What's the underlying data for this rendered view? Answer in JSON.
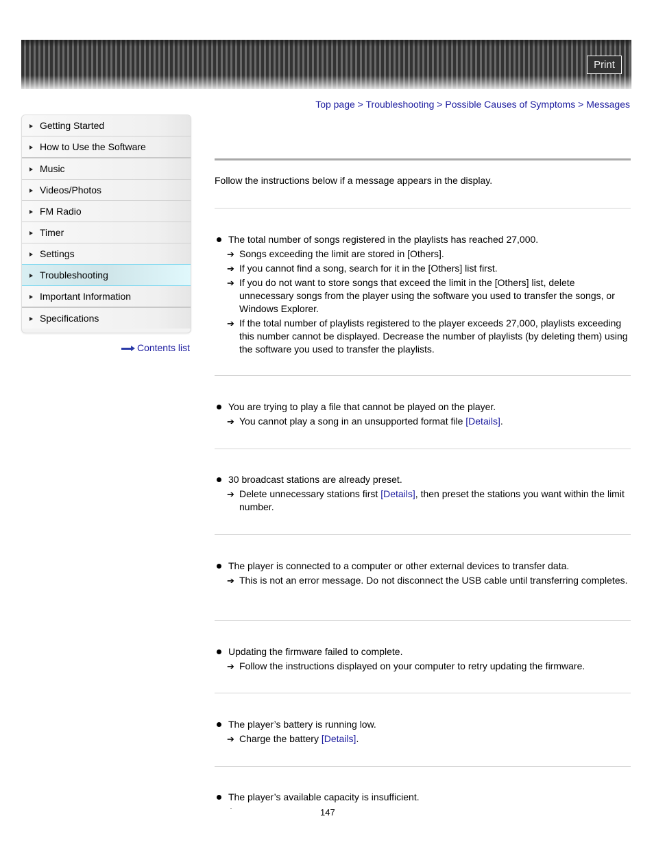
{
  "header": {
    "print_label": "Print"
  },
  "breadcrumb": {
    "items": [
      "Top page",
      "Troubleshooting",
      "Possible Causes of Symptoms",
      "Messages"
    ],
    "separator": " > "
  },
  "sidebar": {
    "items": [
      {
        "label": "Getting Started"
      },
      {
        "label": "How to Use the Software"
      },
      {
        "label": "Music"
      },
      {
        "label": "Videos/Photos"
      },
      {
        "label": "FM Radio"
      },
      {
        "label": "Timer"
      },
      {
        "label": "Settings"
      },
      {
        "label": "Troubleshooting",
        "active": true
      },
      {
        "label": "Important Information"
      },
      {
        "label": "Specifications"
      }
    ],
    "contents_link": "Contents list"
  },
  "main": {
    "intro": "Follow the instructions below if a message appears in the display.",
    "arrow_glyph": "➔",
    "sections": [
      {
        "cause": "The total number of songs registered in the playlists has reached 27,000.",
        "remedies": [
          {
            "text": "Songs exceeding the limit are stored in [Others]."
          },
          {
            "text": "If you cannot find a song, search for it in the [Others] list first."
          },
          {
            "text": "If you do not want to store songs that exceed the limit in the [Others] list, delete unnecessary songs from the player using the software you used to transfer the songs, or Windows Explorer."
          },
          {
            "text": "If the total number of playlists registered to the player exceeds 27,000, playlists exceeding this number cannot be displayed. Decrease the number of playlists (by deleting them) using the software you used to transfer the playlists."
          }
        ]
      },
      {
        "cause": "You are trying to play a file that cannot be played on the player.",
        "remedies": [
          {
            "before": "You cannot play a song in an unsupported format file ",
            "link": "[Details]",
            "after": "."
          }
        ]
      },
      {
        "cause": "30 broadcast stations are already preset.",
        "remedies": [
          {
            "before": "Delete unnecessary stations first ",
            "link": "[Details]",
            "after": ", then preset the stations you want within the limit number."
          }
        ]
      },
      {
        "cause": "The player is connected to a computer or other external devices to transfer data.",
        "remedies": [
          {
            "text": "This is not an error message. Do not disconnect the USB cable until transferring completes."
          }
        ]
      },
      {
        "cause": "Updating the firmware failed to complete.",
        "remedies": [
          {
            "text": "Follow the instructions displayed on your computer to retry updating the firmware."
          }
        ]
      },
      {
        "cause": "The player’s battery is running low.",
        "remedies": [
          {
            "before": "Charge the battery ",
            "link": "[Details]",
            "after": "."
          }
        ]
      },
      {
        "cause": "The player’s available capacity is insufficient.",
        "remedies": []
      }
    ]
  },
  "footer": {
    "page_number": "147"
  }
}
